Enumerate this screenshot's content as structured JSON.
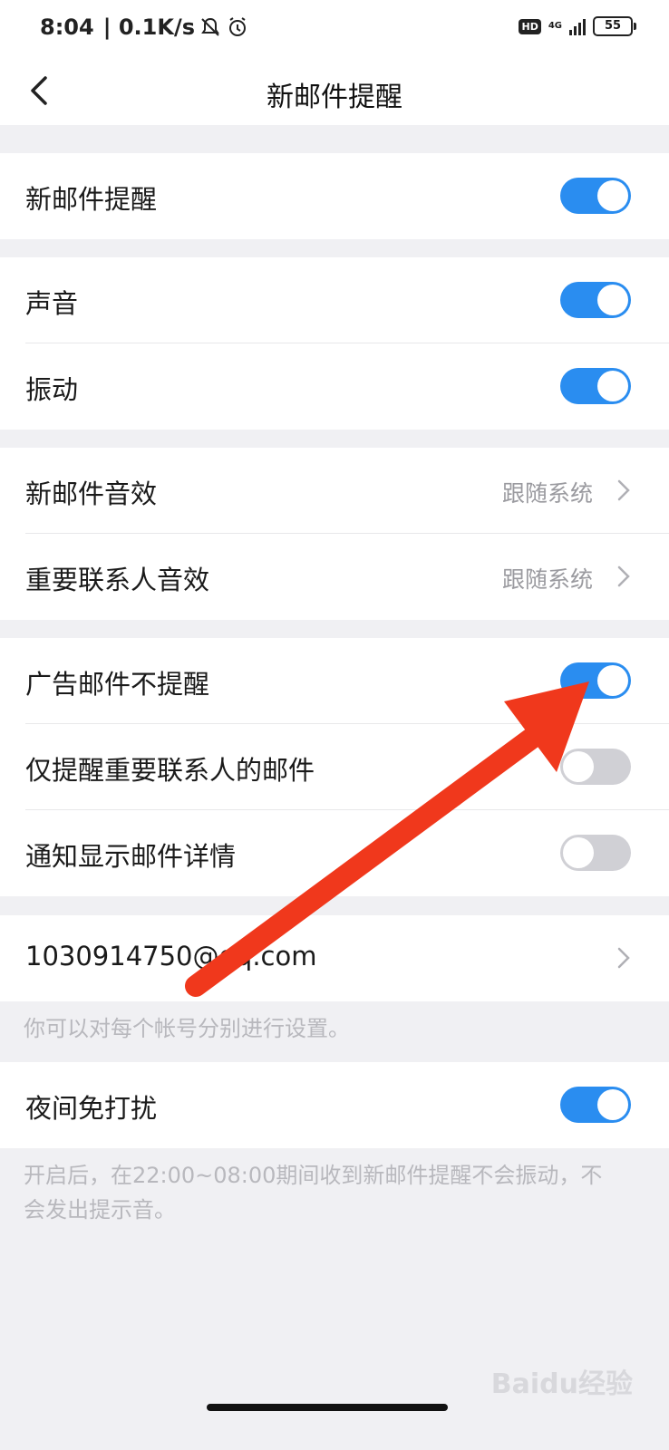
{
  "status_bar": {
    "time": "8:04",
    "speed": "| 0.1K/s",
    "hd": "HD",
    "network": "4G",
    "battery": "55"
  },
  "header": {
    "title": "新邮件提醒"
  },
  "rows": {
    "new_mail_alert": "新邮件提醒",
    "sound": "声音",
    "vibration": "振动",
    "new_mail_sound": "新邮件音效",
    "new_mail_sound_value": "跟随系统",
    "vip_sound": "重要联系人音效",
    "vip_sound_value": "跟随系统",
    "ad_no_alert": "广告邮件不提醒",
    "vip_only": "仅提醒重要联系人的邮件",
    "show_details": "通知显示邮件详情",
    "account": "1030914750@qq.com",
    "night_mode": "夜间免打扰"
  },
  "toggles": {
    "new_mail_alert": true,
    "sound": true,
    "vibration": true,
    "ad_no_alert": true,
    "vip_only": false,
    "show_details": false,
    "night_mode": true
  },
  "hints": {
    "account_hint": "你可以对每个帐号分别进行设置。",
    "night_hint_line1": "开启后，在22:00~08:00期间收到新邮件提醒不会振动，不",
    "night_hint_line2": "会发出提示音。"
  },
  "watermark": "Baidu经验",
  "colors": {
    "toggle_on": "#2a8df0",
    "toggle_off": "#d0d0d5",
    "annotation_arrow": "#f0381c"
  },
  "icons": [
    "mute-bell-icon",
    "alarm-icon",
    "signal-icon",
    "battery-icon",
    "back-arrow-icon",
    "chevron-right-icon"
  ]
}
